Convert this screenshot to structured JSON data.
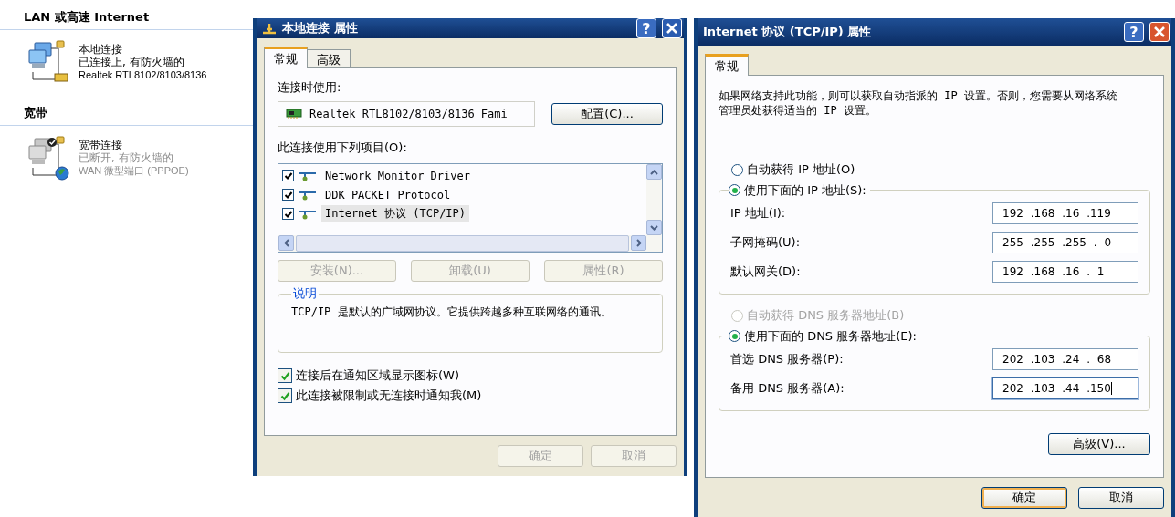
{
  "explorer": {
    "sections": [
      {
        "title": "LAN 或高速 Internet",
        "connections": [
          {
            "kind": "lan",
            "name": "本地连接",
            "status": "已连接上, 有防火墙的",
            "device": "Realtek RTL8102/8103/8136",
            "connected": true,
            "default": false
          }
        ]
      },
      {
        "title": "宽带",
        "connections": [
          {
            "kind": "dialup",
            "name": "宽带连接",
            "status": "已断开, 有防火墙的",
            "device": "WAN 微型端口 (PPPOE)",
            "connected": false,
            "default": true
          }
        ]
      }
    ]
  },
  "lan_dialog": {
    "title": "本地连接 属性",
    "help_button": "?",
    "tabs": [
      {
        "label": "常规",
        "selected": true
      },
      {
        "label": "高级",
        "selected": false
      }
    ],
    "connect_using_label": "连接时使用:",
    "adapter": "Realtek RTL8102/8103/8136 Fami",
    "configure_button": "配置(C)...",
    "items_label": "此连接使用下列项目(O):",
    "items": [
      {
        "label": "Network Monitor Driver",
        "checked": true,
        "selected": false
      },
      {
        "label": "DDK PACKET Protocol",
        "checked": true,
        "selected": false
      },
      {
        "label": "Internet 协议 (TCP/IP)",
        "checked": true,
        "selected": true
      }
    ],
    "item_buttons": [
      {
        "label": "安装(N)...",
        "disabled": true
      },
      {
        "label": "卸载(U)",
        "disabled": true
      },
      {
        "label": "属性(R)",
        "disabled": true
      }
    ],
    "description_title": "说明",
    "description": "TCP/IP 是默认的广域网协议。它提供跨越多种互联网络的通讯。",
    "options": [
      {
        "label": "连接后在通知区域显示图标(W)",
        "checked": true
      },
      {
        "label": "此连接被限制或无连接时通知我(M)",
        "checked": true
      }
    ],
    "buttons": [
      {
        "label": "确定",
        "disabled": true,
        "default": false
      },
      {
        "label": "取消",
        "disabled": true,
        "default": false
      }
    ]
  },
  "tcpip_dialog": {
    "title": "Internet 协议 (TCP/IP) 属性",
    "help_button": "?",
    "tabs": [
      {
        "label": "常规",
        "selected": true
      }
    ],
    "intro": "如果网络支持此功能，则可以获取自动指派的 IP 设置。否则，您需要从网络系统管理员处获得适当的 IP 设置。",
    "ip_auto": {
      "label": "自动获得 IP 地址(O)",
      "selected": false,
      "disabled": false
    },
    "ip_manual": {
      "label": "使用下面的 IP 地址(S):",
      "selected": true,
      "disabled": false
    },
    "ip_fields": [
      {
        "label": "IP 地址(I):",
        "value": "192 .168 .16 .119",
        "focused": false
      },
      {
        "label": "子网掩码(U):",
        "value": "255 .255 .255 . 0",
        "focused": false
      },
      {
        "label": "默认网关(D):",
        "value": "192 .168 .16 . 1",
        "focused": false
      }
    ],
    "dns_auto": {
      "label": "自动获得 DNS 服务器地址(B)",
      "selected": false,
      "disabled": true
    },
    "dns_manual": {
      "label": "使用下面的 DNS 服务器地址(E):",
      "selected": true,
      "disabled": false
    },
    "dns_fields": [
      {
        "label": "首选 DNS 服务器(P):",
        "value": "202 .103 .24 . 68",
        "focused": false
      },
      {
        "label": "备用 DNS 服务器(A):",
        "value": "202 .103 .44 .150",
        "focused": true
      }
    ],
    "advanced_button": "高级(V)...",
    "buttons": [
      {
        "label": "确定",
        "disabled": false,
        "default": true
      },
      {
        "label": "取消",
        "disabled": false,
        "default": false
      }
    ]
  }
}
